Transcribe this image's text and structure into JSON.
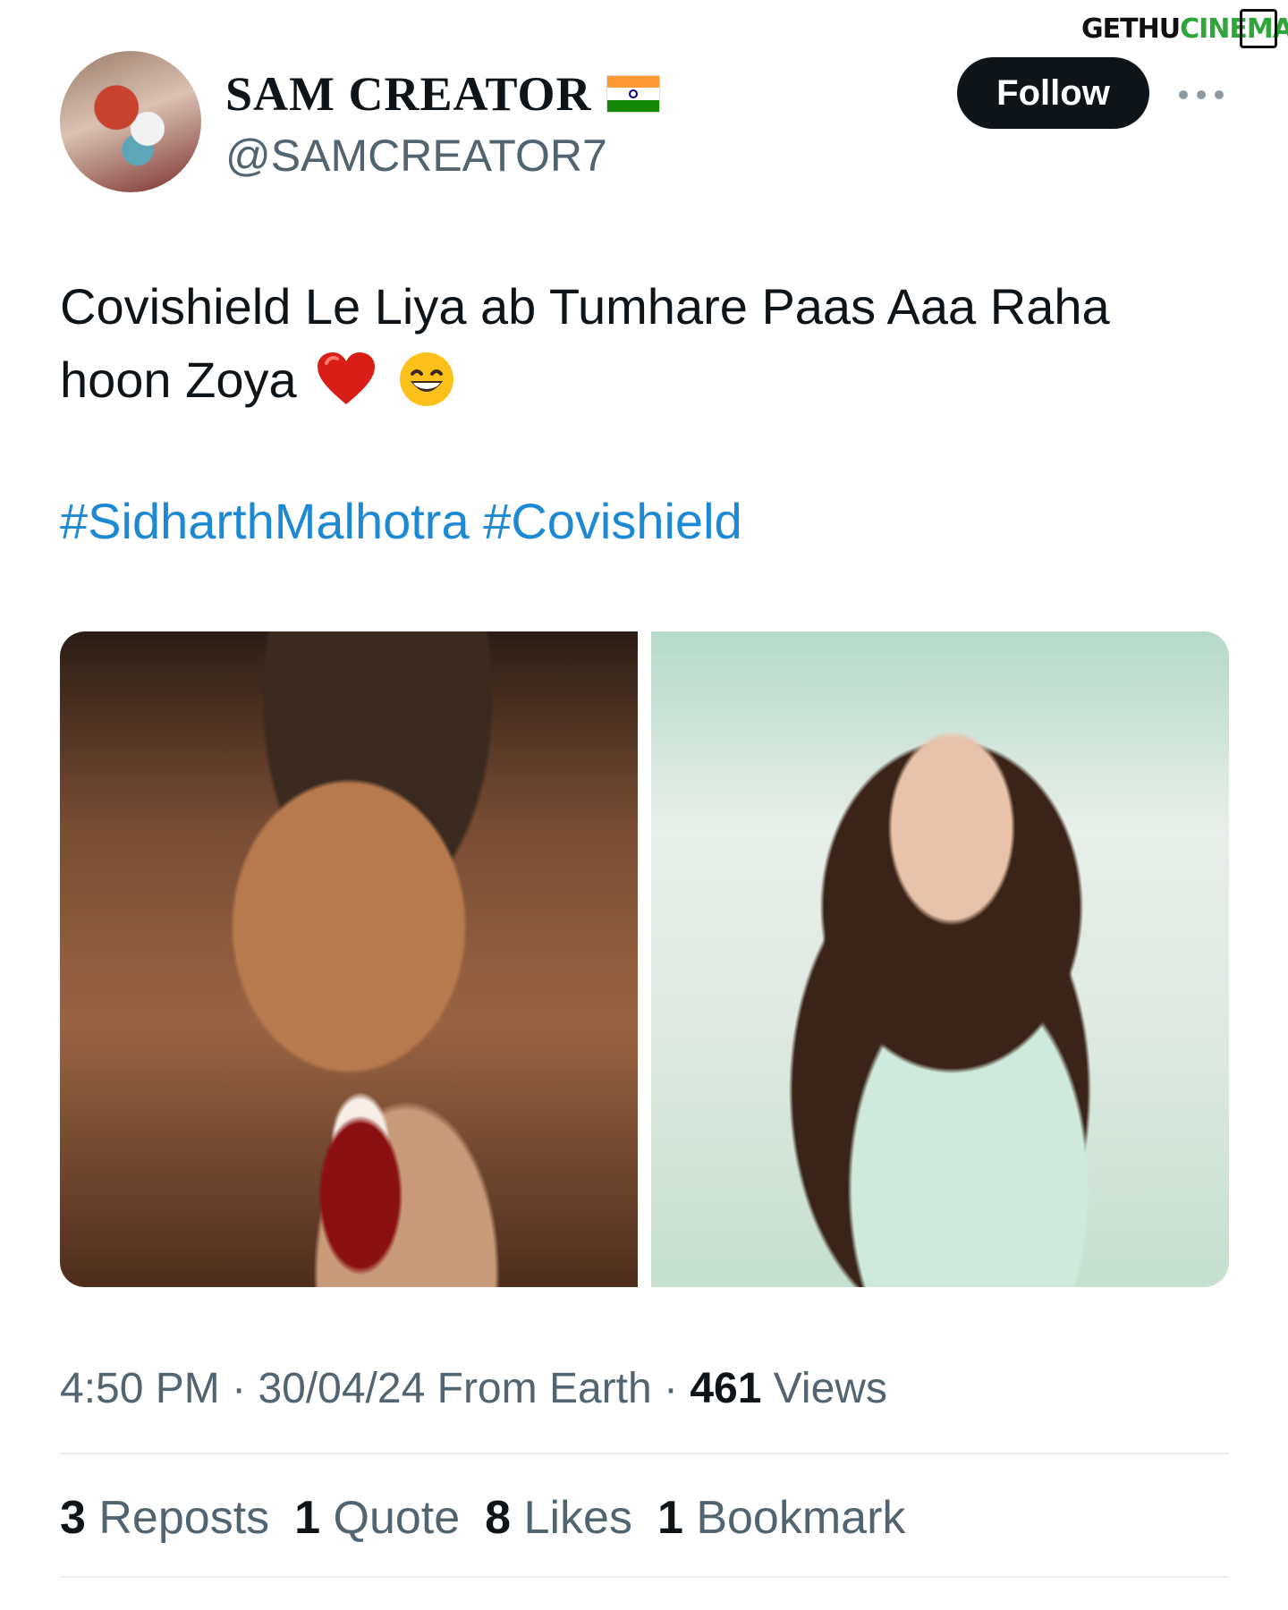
{
  "watermark": {
    "text_a": "GETHU",
    "text_b": "CINEMA"
  },
  "author": {
    "display_name": "SAM CREATOR",
    "flag": "india-flag",
    "handle": "@SAMCREATOR7"
  },
  "actions": {
    "follow_label": "Follow",
    "more_icon": "more-horizontal-icon"
  },
  "tweet": {
    "text_line1": "Covishield Le Liya ab Tumhare Paas Aaa Raha",
    "text_line2": "hoon Zoya",
    "emojis": [
      "red-heart-emoji",
      "grinning-face-emoji"
    ],
    "hashtags": [
      "#SidharthMalhotra",
      "#Covishield"
    ]
  },
  "media": [
    {
      "name": "photo-man-bloodied-face"
    },
    {
      "name": "photo-woman-green-outfit"
    }
  ],
  "meta": {
    "time": "4:50 PM",
    "sep": "·",
    "date": "30/04/24",
    "source": "From Earth",
    "views_count": "461",
    "views_label": "Views"
  },
  "stats": {
    "reposts_count": "3",
    "reposts_label": "Reposts",
    "quote_count": "1",
    "quote_label": "Quote",
    "likes_count": "8",
    "likes_label": "Likes",
    "bookmark_count": "1",
    "bookmark_label": "Bookmark"
  },
  "colors": {
    "accent_link": "#1d89d4",
    "follow_bg": "#0f1419",
    "muted": "#536471"
  }
}
